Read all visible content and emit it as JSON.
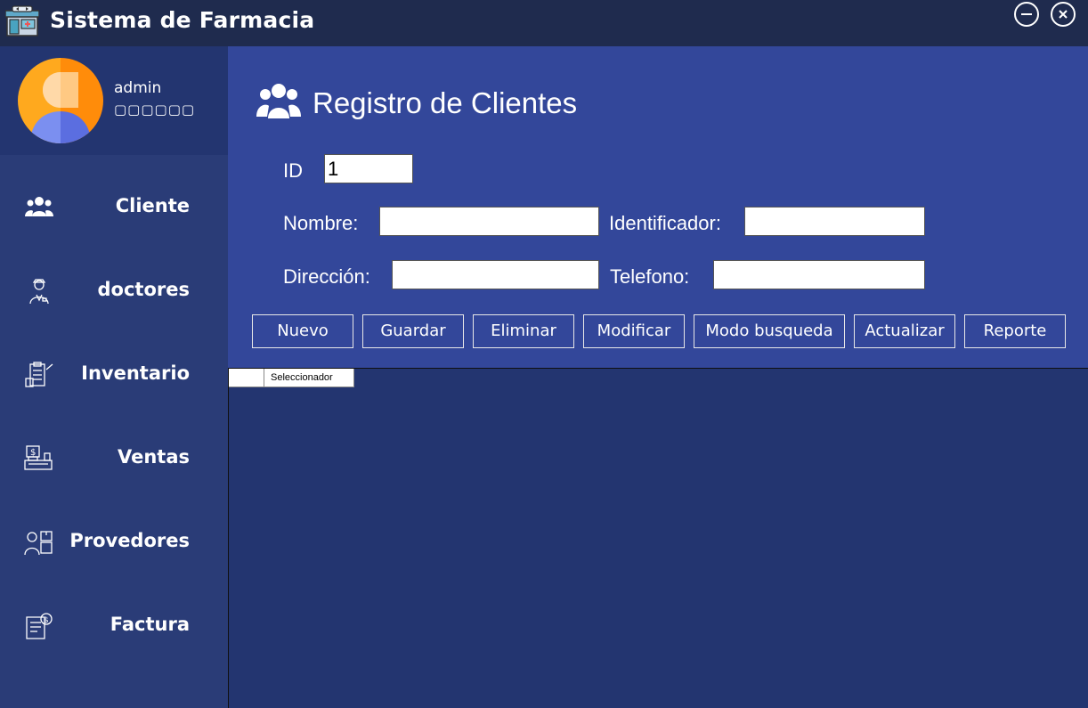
{
  "window": {
    "title": "Sistema de Farmacia"
  },
  "user": {
    "name": "admin",
    "role": "▢▢▢▢▢▢"
  },
  "sidebar": {
    "items": [
      {
        "label": "Cliente",
        "icon": "clients-icon"
      },
      {
        "label": "doctores",
        "icon": "doctor-icon"
      },
      {
        "label": "Inventario",
        "icon": "inventory-icon"
      },
      {
        "label": "Ventas",
        "icon": "cash-register-icon"
      },
      {
        "label": "Provedores",
        "icon": "supplier-icon"
      },
      {
        "label": "Factura",
        "icon": "invoice-icon"
      }
    ]
  },
  "page": {
    "title": "Registro de Clientes"
  },
  "form": {
    "id": {
      "label": "ID",
      "value": "1"
    },
    "nombre": {
      "label": "Nombre:",
      "value": ""
    },
    "identificador": {
      "label": "Identificador:",
      "value": ""
    },
    "direccion": {
      "label": "Dirección:",
      "value": ""
    },
    "telefono": {
      "label": "Telefono:",
      "value": ""
    }
  },
  "buttons": [
    "Nuevo",
    "Guardar",
    "Eliminar",
    "Modificar",
    "Modo busqueda",
    "Actualizar",
    "Reporte"
  ],
  "grid": {
    "columns": [
      "Seleccionador"
    ],
    "rows": []
  },
  "colors": {
    "titlebar": "#1f2b4e",
    "sidebar": "#2a3c77",
    "content": "#33479a",
    "grid_bg": "#233570",
    "avatar_orange": "#ff9f1c",
    "avatar_blue": "#7b8ff0"
  }
}
